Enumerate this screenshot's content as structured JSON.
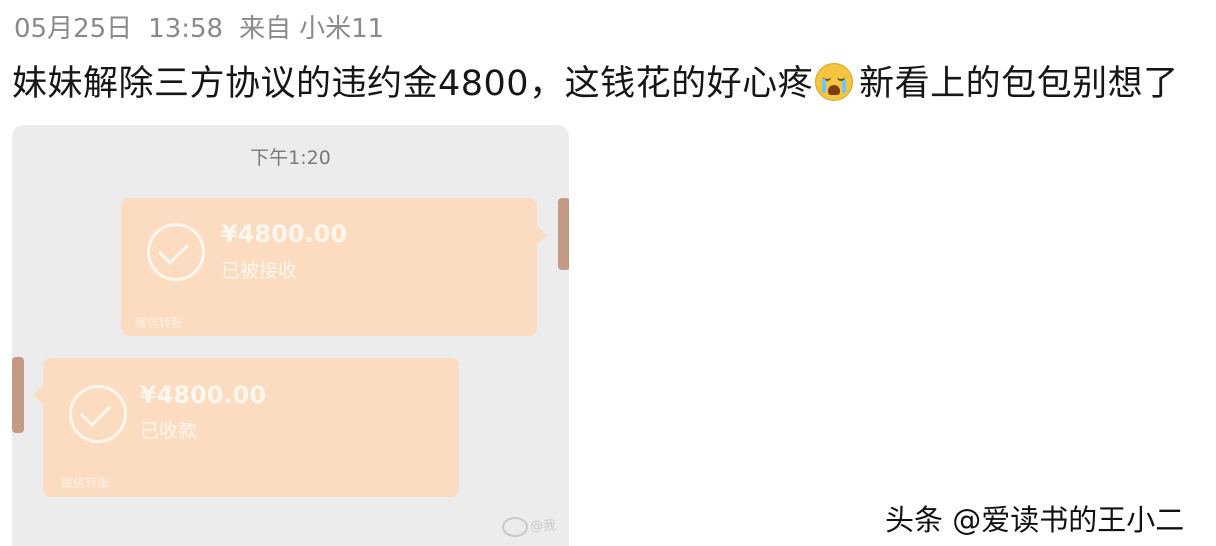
{
  "post": {
    "date": "05月25日",
    "time": "13:58",
    "source_prefix": "来自",
    "source_device": "小米11",
    "text_part1": "妹妹解除三方协议的违约金4800，这钱花的好心疼",
    "emoji_icon": "crying-face-icon",
    "text_part2": "新看上的包包别想了"
  },
  "screenshot": {
    "timestamp": "下午1:20",
    "cards": [
      {
        "amount": "¥4800.00",
        "status": "已被接收",
        "footer": "微信转账"
      },
      {
        "amount": "¥4800.00",
        "status": "已收款",
        "footer": "微信转账"
      }
    ],
    "weibo_watermark": "@我"
  },
  "watermark": "头条 @爱读书的王小二",
  "colors": {
    "card_orange": "#fbdcc0",
    "chat_bg": "#ececec",
    "meta_gray": "#8a8a8a"
  }
}
